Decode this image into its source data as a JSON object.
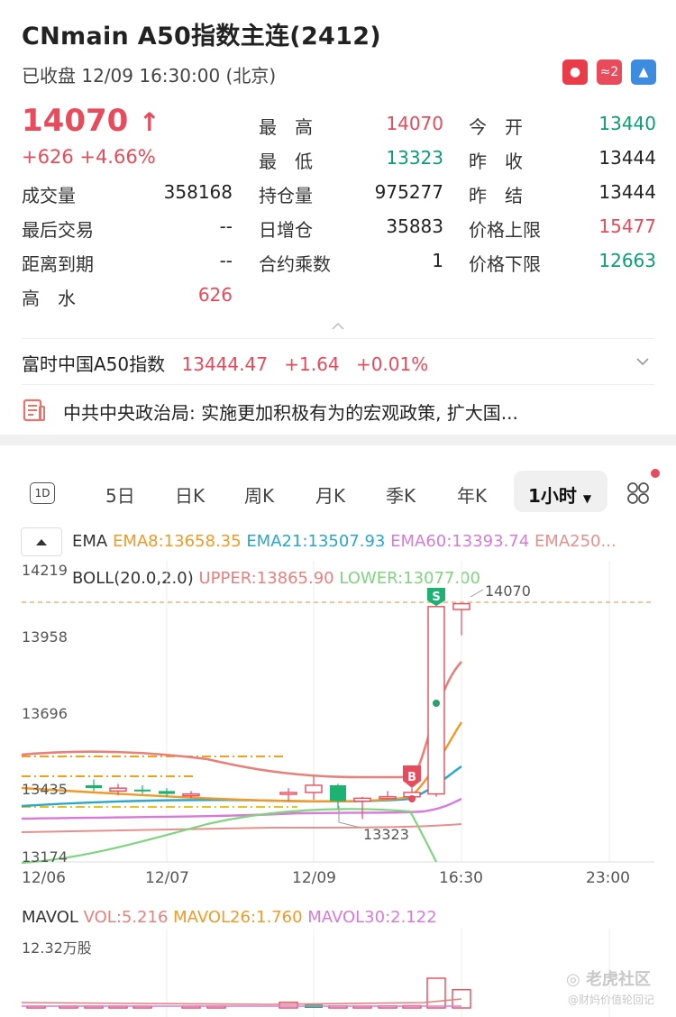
{
  "header": {
    "title": "CNmain  A50指数主连(2412)",
    "status": "已收盘   12/09 16:30:00 (北京)",
    "flags": {
      "sg": "●",
      "cb": "≈2",
      "ex": "▲"
    }
  },
  "quote": {
    "price": "14070",
    "arrow": "↑",
    "change": "+626   +4.66%",
    "rows": [
      {
        "l1": "成交量",
        "v1": "358168",
        "l2": "持仓量",
        "v2": "975277",
        "l3": "昨　结",
        "v3": "13444"
      },
      {
        "l1": "最后交易",
        "v1": "--",
        "l2": "日增仓",
        "v2": "35883",
        "l3": "价格上限",
        "v3": "15477"
      },
      {
        "l1": "距离到期",
        "v1": "--",
        "l2": "合约乘数",
        "v2": "1",
        "l3": "价格下限",
        "v3": "12663"
      },
      {
        "l1": "高　水",
        "v1": "626"
      }
    ],
    "top_rows": [
      {
        "l2": "最　高",
        "v2": "14070",
        "l3": "今　开",
        "v3": "13440"
      },
      {
        "l2": "最　低",
        "v2": "13323",
        "l3": "昨　收",
        "v3": "13444"
      }
    ]
  },
  "index": {
    "name": "富时中国A50指数",
    "value": "13444.47",
    "change": "+1.64",
    "pct": "+0.01%"
  },
  "news": {
    "text": "中共中央政治局: 实施更加积极有为的宏观政策, 扩大国..."
  },
  "tabs": {
    "oned": "1D",
    "items": [
      "5日",
      "日K",
      "周K",
      "月K",
      "季K",
      "年K"
    ],
    "active": "1小时"
  },
  "indicators": {
    "ema_label": "EMA",
    "ema8": "EMA8:13658.35",
    "ema21": "EMA21:13507.93",
    "ema60": "EMA60:13393.74",
    "ema250": "EMA250...",
    "boll": "BOLL(20.0,2.0)",
    "upper": "UPPER:13865.90",
    "lower": "LOWER:13077.00",
    "price_tag": "14070",
    "low_tag": "13323",
    "s_marker": "S",
    "b_marker": "B"
  },
  "chart_data": {
    "type": "candlestick",
    "y_ticks": [
      "14219",
      "13958",
      "13696",
      "13435",
      "13174"
    ],
    "ylim": [
      13174,
      14219
    ],
    "x_ticks": [
      "12/06",
      "12/07",
      "12/09",
      "16:30",
      "23:00"
    ],
    "last_price": 14070,
    "candles": [
      {
        "o": 13440,
        "c": 13430,
        "h": 13460,
        "l": 13420,
        "up": false
      },
      {
        "o": 13430,
        "c": 13420,
        "h": 13445,
        "l": 13405,
        "up": true
      },
      {
        "o": 13425,
        "c": 13420,
        "h": 13440,
        "l": 13410,
        "up": false
      },
      {
        "o": 13420,
        "c": 13410,
        "h": 13430,
        "l": 13400,
        "up": false
      },
      {
        "o": 13405,
        "c": 13410,
        "h": 13420,
        "l": 13395,
        "up": true
      },
      {
        "o": 13410,
        "c": 13415,
        "h": 13430,
        "l": 13385,
        "up": true
      },
      {
        "o": 13415,
        "c": 13440,
        "h": 13470,
        "l": 13390,
        "up": true
      },
      {
        "o": 13440,
        "c": 13385,
        "h": 13445,
        "l": 13360,
        "up": false
      },
      {
        "o": 13385,
        "c": 13395,
        "h": 13400,
        "l": 13323,
        "up": true
      },
      {
        "o": 13395,
        "c": 13400,
        "h": 13420,
        "l": 13390,
        "up": true
      },
      {
        "o": 13400,
        "c": 13415,
        "h": 13430,
        "l": 13380,
        "up": true
      },
      {
        "o": 13410,
        "c": 14060,
        "h": 14070,
        "l": 13400,
        "up": true
      },
      {
        "o": 14050,
        "c": 14070,
        "h": 14070,
        "l": 13960,
        "up": true
      }
    ]
  },
  "volume": {
    "mavol": "MAVOL",
    "vol": "VOL:5.216",
    "mavol26": "MAVOL26:1.760",
    "mavol30": "MAVOL30:2.122",
    "max_label": "12.32万股",
    "values": [
      0.05,
      0.05,
      0.05,
      0.06,
      0.05,
      0.1,
      0.1,
      1.0,
      0.6,
      0.35,
      0.3,
      0.35,
      0.4,
      5.216,
      3.2
    ],
    "ymax": 12.32
  },
  "watermark": {
    "brand": "老虎社区",
    "handle": "@财妈价值轮回记"
  }
}
